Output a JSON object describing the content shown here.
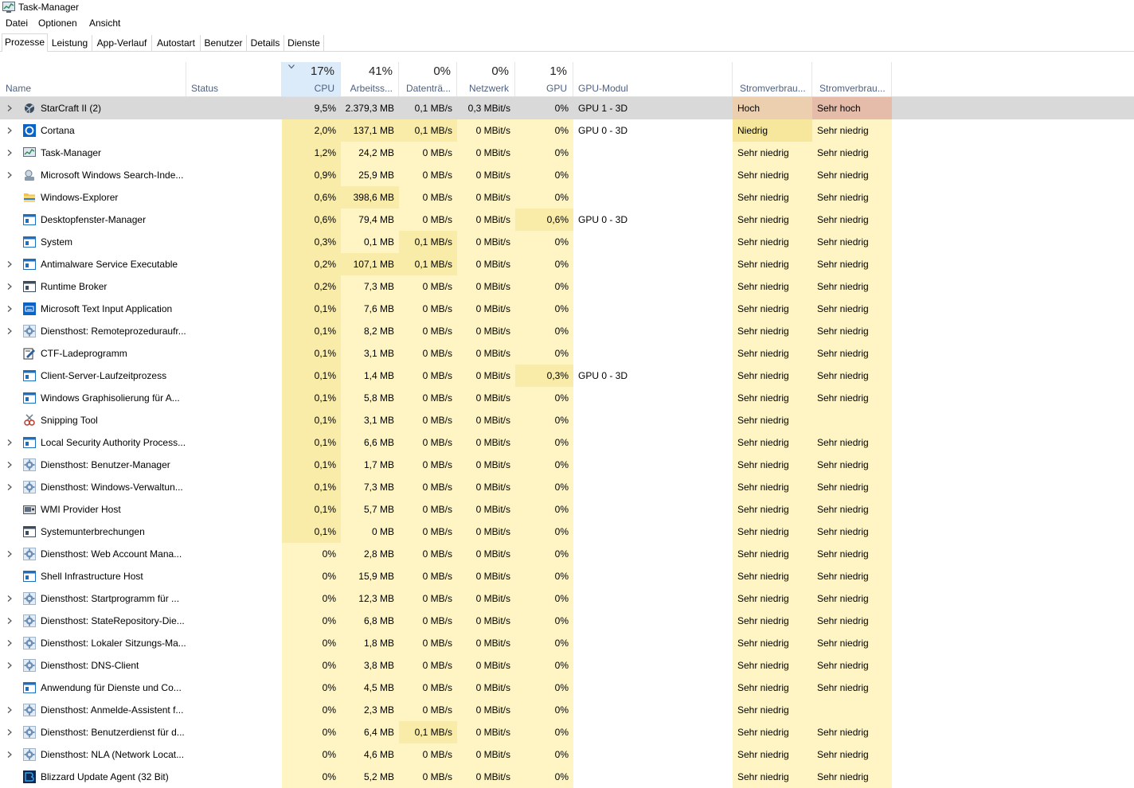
{
  "window": {
    "title": "Task-Manager"
  },
  "menu": [
    "Datei",
    "Optionen",
    "Ansicht"
  ],
  "tabs": [
    "Prozesse",
    "Leistung",
    "App-Verlauf",
    "Autostart",
    "Benutzer",
    "Details",
    "Dienste"
  ],
  "active_tab": "Prozesse",
  "header": {
    "name": "Name",
    "status": "Status",
    "cpu_pct": "17%",
    "cpu": "CPU",
    "mem_pct": "41%",
    "mem": "Arbeitss...",
    "disk_pct": "0%",
    "disk": "Datenträ...",
    "net_pct": "0%",
    "net": "Netzwerk",
    "gpu_pct": "1%",
    "gpu": "GPU",
    "gpu_engine": "GPU-Modul",
    "power": "Stromverbrau...",
    "power_trend": "Stromverbrau..."
  },
  "colors": {
    "heat_light": "#fff4c4",
    "heat_mid": "#f9eca8",
    "selected_row": "#d9d9d9",
    "power_high": "#ebcfae",
    "power_very_high": "#e5bcaa",
    "power_low": "#f7e79c",
    "header_label": "#4d6082"
  },
  "processes": [
    {
      "expand": true,
      "icon": "starcraft-icon",
      "name": "StarCraft II (2)",
      "cpu": "9,5%",
      "mem": "2.379,3 MB",
      "disk": "0,1 MB/s",
      "net": "0,3 MBit/s",
      "gpu": "0%",
      "gpu_engine": "GPU 1 - 3D",
      "power": "Hoch",
      "power_trend": "Sehr hoch",
      "selected": true
    },
    {
      "expand": true,
      "icon": "cortana-icon",
      "name": "Cortana",
      "cpu": "2,0%",
      "mem": "137,1 MB",
      "disk": "0,1 MB/s",
      "net": "0 MBit/s",
      "gpu": "0%",
      "gpu_engine": "GPU 0 - 3D",
      "power": "Niedrig",
      "power_trend": "Sehr niedrig"
    },
    {
      "expand": true,
      "icon": "task-manager-icon",
      "name": "Task-Manager",
      "cpu": "1,2%",
      "mem": "24,2 MB",
      "disk": "0 MB/s",
      "net": "0 MBit/s",
      "gpu": "0%",
      "gpu_engine": "",
      "power": "Sehr niedrig",
      "power_trend": "Sehr niedrig"
    },
    {
      "expand": true,
      "icon": "search-indexer-icon",
      "name": "Microsoft Windows Search-Inde...",
      "cpu": "0,9%",
      "mem": "25,9 MB",
      "disk": "0 MB/s",
      "net": "0 MBit/s",
      "gpu": "0%",
      "gpu_engine": "",
      "power": "Sehr niedrig",
      "power_trend": "Sehr niedrig"
    },
    {
      "expand": false,
      "icon": "folder-icon",
      "name": "Windows-Explorer",
      "cpu": "0,6%",
      "mem": "398,6 MB",
      "disk": "0 MB/s",
      "net": "0 MBit/s",
      "gpu": "0%",
      "gpu_engine": "",
      "power": "Sehr niedrig",
      "power_trend": "Sehr niedrig"
    },
    {
      "expand": false,
      "icon": "window-icon",
      "name": "Desktopfenster-Manager",
      "cpu": "0,6%",
      "mem": "79,4 MB",
      "disk": "0 MB/s",
      "net": "0 MBit/s",
      "gpu": "0,6%",
      "gpu_engine": "GPU 0 - 3D",
      "power": "Sehr niedrig",
      "power_trend": "Sehr niedrig"
    },
    {
      "expand": false,
      "icon": "window-icon",
      "name": "System",
      "cpu": "0,3%",
      "mem": "0,1 MB",
      "disk": "0,1 MB/s",
      "net": "0 MBit/s",
      "gpu": "0%",
      "gpu_engine": "",
      "power": "Sehr niedrig",
      "power_trend": "Sehr niedrig"
    },
    {
      "expand": true,
      "icon": "window-icon",
      "name": "Antimalware Service Executable",
      "cpu": "0,2%",
      "mem": "107,1 MB",
      "disk": "0,1 MB/s",
      "net": "0 MBit/s",
      "gpu": "0%",
      "gpu_engine": "",
      "power": "Sehr niedrig",
      "power_trend": "Sehr niedrig"
    },
    {
      "expand": true,
      "icon": "window-dark-icon",
      "name": "Runtime Broker",
      "cpu": "0,2%",
      "mem": "7,3 MB",
      "disk": "0 MB/s",
      "net": "0 MBit/s",
      "gpu": "0%",
      "gpu_engine": "",
      "power": "Sehr niedrig",
      "power_trend": "Sehr niedrig"
    },
    {
      "expand": true,
      "icon": "keyboard-icon",
      "name": "Microsoft Text Input Application",
      "cpu": "0,1%",
      "mem": "7,6 MB",
      "disk": "0 MB/s",
      "net": "0 MBit/s",
      "gpu": "0%",
      "gpu_engine": "",
      "power": "Sehr niedrig",
      "power_trend": "Sehr niedrig"
    },
    {
      "expand": true,
      "icon": "gear-icon",
      "name": "Diensthost: Remoteprozeduraufr...",
      "cpu": "0,1%",
      "mem": "8,2 MB",
      "disk": "0 MB/s",
      "net": "0 MBit/s",
      "gpu": "0%",
      "gpu_engine": "",
      "power": "Sehr niedrig",
      "power_trend": "Sehr niedrig"
    },
    {
      "expand": false,
      "icon": "ctf-loader-icon",
      "name": "CTF-Ladeprogramm",
      "cpu": "0,1%",
      "mem": "3,1 MB",
      "disk": "0 MB/s",
      "net": "0 MBit/s",
      "gpu": "0%",
      "gpu_engine": "",
      "power": "Sehr niedrig",
      "power_trend": "Sehr niedrig"
    },
    {
      "expand": false,
      "icon": "window-icon",
      "name": "Client-Server-Laufzeitprozess",
      "cpu": "0,1%",
      "mem": "1,4 MB",
      "disk": "0 MB/s",
      "net": "0 MBit/s",
      "gpu": "0,3%",
      "gpu_engine": "GPU 0 - 3D",
      "power": "Sehr niedrig",
      "power_trend": "Sehr niedrig"
    },
    {
      "expand": false,
      "icon": "window-icon",
      "name": "Windows Graphisolierung für A...",
      "cpu": "0,1%",
      "mem": "5,8 MB",
      "disk": "0 MB/s",
      "net": "0 MBit/s",
      "gpu": "0%",
      "gpu_engine": "",
      "power": "Sehr niedrig",
      "power_trend": "Sehr niedrig"
    },
    {
      "expand": false,
      "icon": "snipping-tool-icon",
      "name": "Snipping Tool",
      "cpu": "0,1%",
      "mem": "3,1 MB",
      "disk": "0 MB/s",
      "net": "0 MBit/s",
      "gpu": "0%",
      "gpu_engine": "",
      "power": "Sehr niedrig",
      "power_trend": ""
    },
    {
      "expand": true,
      "icon": "window-icon",
      "name": "Local Security Authority Process...",
      "cpu": "0,1%",
      "mem": "6,6 MB",
      "disk": "0 MB/s",
      "net": "0 MBit/s",
      "gpu": "0%",
      "gpu_engine": "",
      "power": "Sehr niedrig",
      "power_trend": "Sehr niedrig"
    },
    {
      "expand": true,
      "icon": "gear-icon",
      "name": "Diensthost: Benutzer-Manager",
      "cpu": "0,1%",
      "mem": "1,7 MB",
      "disk": "0 MB/s",
      "net": "0 MBit/s",
      "gpu": "0%",
      "gpu_engine": "",
      "power": "Sehr niedrig",
      "power_trend": "Sehr niedrig"
    },
    {
      "expand": true,
      "icon": "gear-icon",
      "name": "Diensthost: Windows-Verwaltun...",
      "cpu": "0,1%",
      "mem": "7,3 MB",
      "disk": "0 MB/s",
      "net": "0 MBit/s",
      "gpu": "0%",
      "gpu_engine": "",
      "power": "Sehr niedrig",
      "power_trend": "Sehr niedrig"
    },
    {
      "expand": false,
      "icon": "wmi-icon",
      "name": "WMI Provider Host",
      "cpu": "0,1%",
      "mem": "5,7 MB",
      "disk": "0 MB/s",
      "net": "0 MBit/s",
      "gpu": "0%",
      "gpu_engine": "",
      "power": "Sehr niedrig",
      "power_trend": "Sehr niedrig"
    },
    {
      "expand": false,
      "icon": "window-dark-icon",
      "name": "Systemunterbrechungen",
      "cpu": "0,1%",
      "mem": "0 MB",
      "disk": "0 MB/s",
      "net": "0 MBit/s",
      "gpu": "0%",
      "gpu_engine": "",
      "power": "Sehr niedrig",
      "power_trend": "Sehr niedrig"
    },
    {
      "expand": true,
      "icon": "gear-icon",
      "name": "Diensthost: Web Account Mana...",
      "cpu": "0%",
      "mem": "2,8 MB",
      "disk": "0 MB/s",
      "net": "0 MBit/s",
      "gpu": "0%",
      "gpu_engine": "",
      "power": "Sehr niedrig",
      "power_trend": "Sehr niedrig"
    },
    {
      "expand": false,
      "icon": "window-icon",
      "name": "Shell Infrastructure Host",
      "cpu": "0%",
      "mem": "15,9 MB",
      "disk": "0 MB/s",
      "net": "0 MBit/s",
      "gpu": "0%",
      "gpu_engine": "",
      "power": "Sehr niedrig",
      "power_trend": "Sehr niedrig"
    },
    {
      "expand": true,
      "icon": "gear-icon",
      "name": "Diensthost: Startprogramm für ...",
      "cpu": "0%",
      "mem": "12,3 MB",
      "disk": "0 MB/s",
      "net": "0 MBit/s",
      "gpu": "0%",
      "gpu_engine": "",
      "power": "Sehr niedrig",
      "power_trend": "Sehr niedrig"
    },
    {
      "expand": true,
      "icon": "gear-icon",
      "name": "Diensthost: StateRepository-Die...",
      "cpu": "0%",
      "mem": "6,8 MB",
      "disk": "0 MB/s",
      "net": "0 MBit/s",
      "gpu": "0%",
      "gpu_engine": "",
      "power": "Sehr niedrig",
      "power_trend": "Sehr niedrig"
    },
    {
      "expand": true,
      "icon": "gear-icon",
      "name": "Diensthost: Lokaler Sitzungs-Ma...",
      "cpu": "0%",
      "mem": "1,8 MB",
      "disk": "0 MB/s",
      "net": "0 MBit/s",
      "gpu": "0%",
      "gpu_engine": "",
      "power": "Sehr niedrig",
      "power_trend": "Sehr niedrig"
    },
    {
      "expand": true,
      "icon": "gear-icon",
      "name": "Diensthost: DNS-Client",
      "cpu": "0%",
      "mem": "3,8 MB",
      "disk": "0 MB/s",
      "net": "0 MBit/s",
      "gpu": "0%",
      "gpu_engine": "",
      "power": "Sehr niedrig",
      "power_trend": "Sehr niedrig"
    },
    {
      "expand": false,
      "icon": "window-icon",
      "name": "Anwendung für Dienste und Co...",
      "cpu": "0%",
      "mem": "4,5 MB",
      "disk": "0 MB/s",
      "net": "0 MBit/s",
      "gpu": "0%",
      "gpu_engine": "",
      "power": "Sehr niedrig",
      "power_trend": "Sehr niedrig"
    },
    {
      "expand": true,
      "icon": "gear-icon",
      "name": "Diensthost: Anmelde-Assistent f...",
      "cpu": "0%",
      "mem": "2,3 MB",
      "disk": "0 MB/s",
      "net": "0 MBit/s",
      "gpu": "0%",
      "gpu_engine": "",
      "power": "Sehr niedrig",
      "power_trend": ""
    },
    {
      "expand": true,
      "icon": "gear-icon",
      "name": "Diensthost: Benutzerdienst für d...",
      "cpu": "0%",
      "mem": "6,4 MB",
      "disk": "0,1 MB/s",
      "net": "0 MBit/s",
      "gpu": "0%",
      "gpu_engine": "",
      "power": "Sehr niedrig",
      "power_trend": "Sehr niedrig"
    },
    {
      "expand": true,
      "icon": "gear-icon",
      "name": "Diensthost: NLA (Network Locat...",
      "cpu": "0%",
      "mem": "4,6 MB",
      "disk": "0 MB/s",
      "net": "0 MBit/s",
      "gpu": "0%",
      "gpu_engine": "",
      "power": "Sehr niedrig",
      "power_trend": "Sehr niedrig"
    },
    {
      "expand": false,
      "icon": "blizzard-icon",
      "name": "Blizzard Update Agent (32 Bit)",
      "cpu": "0%",
      "mem": "5,2 MB",
      "disk": "0 MB/s",
      "net": "0 MBit/s",
      "gpu": "0%",
      "gpu_engine": "",
      "power": "Sehr niedrig",
      "power_trend": "Sehr niedrig"
    }
  ]
}
